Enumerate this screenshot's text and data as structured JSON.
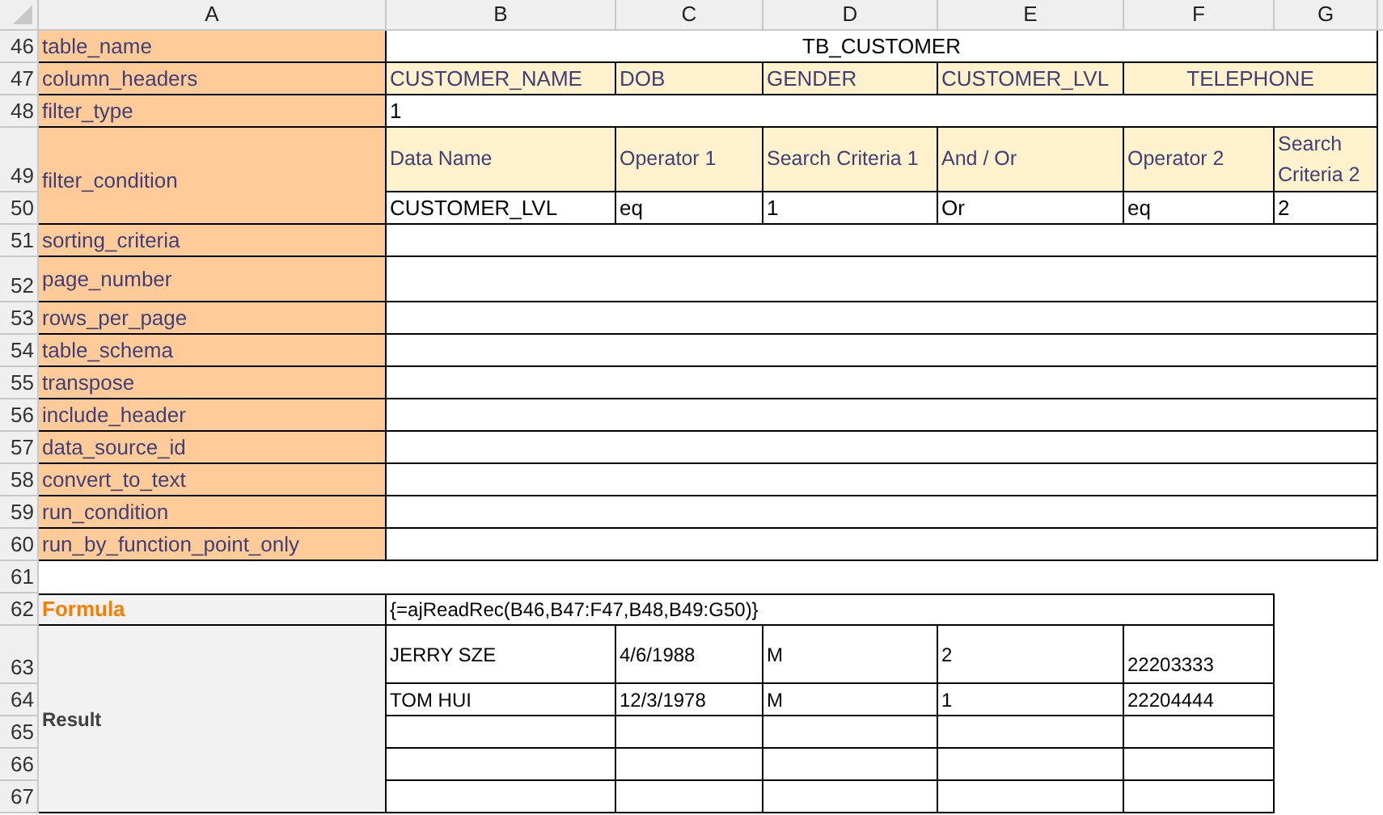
{
  "column_letters": [
    "A",
    "B",
    "C",
    "D",
    "E",
    "F",
    "G"
  ],
  "row_numbers": [
    "46",
    "47",
    "48",
    "49",
    "50",
    "51",
    "52",
    "53",
    "54",
    "55",
    "56",
    "57",
    "58",
    "59",
    "60",
    "61",
    "62",
    "63",
    "64",
    "65",
    "66",
    "67"
  ],
  "parameters": [
    {
      "label": "table_name"
    },
    {
      "label": "column_headers"
    },
    {
      "label": "filter_type"
    },
    {
      "label": "filter_condition"
    },
    {
      "label": "sorting_criteria"
    },
    {
      "label": "page_number"
    },
    {
      "label": "rows_per_page"
    },
    {
      "label": "table_schema"
    },
    {
      "label": "transpose"
    },
    {
      "label": "include_header"
    },
    {
      "label": "data_source_id"
    },
    {
      "label": "convert_to_text"
    },
    {
      "label": "run_condition"
    },
    {
      "label": "run_by_function_point_only"
    }
  ],
  "table_name": "TB_CUSTOMER",
  "column_headers": [
    "CUSTOMER_NAME",
    "DOB",
    "GENDER",
    "CUSTOMER_LVL",
    "TELEPHONE"
  ],
  "filter_type": "1",
  "filter_condition": {
    "headers": [
      "Data Name",
      "Operator 1",
      "Search Criteria 1",
      "And / Or",
      "Operator 2",
      "Search Criteria 2"
    ],
    "values": [
      "CUSTOMER_LVL",
      "eq",
      "1",
      "Or",
      "eq",
      "2"
    ]
  },
  "formula": {
    "label": "Formula",
    "text": "{=ajReadRec(B46,B47:F47,B48,B49:G50)}"
  },
  "result": {
    "label": "Result",
    "rows": [
      [
        "JERRY SZE",
        "4/6/1988",
        "M",
        "2",
        "22203333"
      ],
      [
        "TOM HUI",
        "12/3/1978",
        "M",
        "1",
        "22204444"
      ]
    ]
  }
}
